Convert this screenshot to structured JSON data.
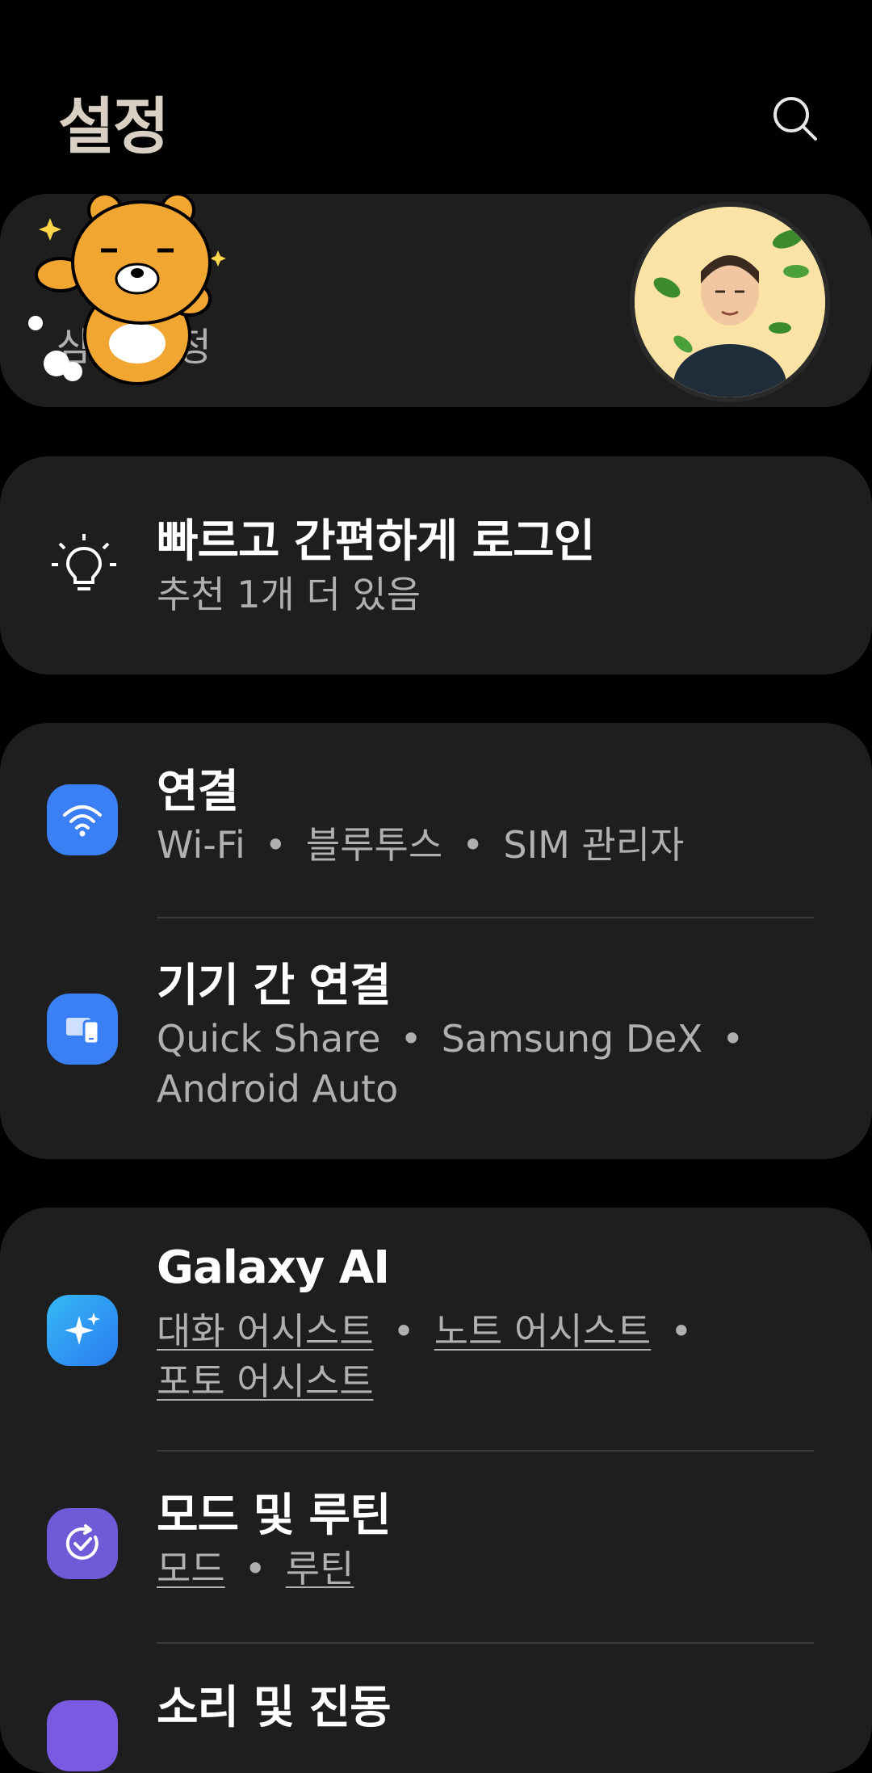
{
  "header": {
    "title": "설정",
    "search_icon": "search-icon"
  },
  "account": {
    "subtitle": "삼성 계정",
    "mascot": "bear-sticker",
    "avatar": "user-avatar"
  },
  "tip": {
    "icon": "lightbulb-icon",
    "title": "빠르고 간편하게 로그인",
    "subtitle": "추천 1개 더 있음"
  },
  "group1": [
    {
      "title": "연결",
      "icon": "wifi-icon",
      "color": "#3b7ff5",
      "sub": [
        "Wi-Fi",
        "블루투스",
        "SIM 관리자"
      ]
    },
    {
      "title": "기기 간 연결",
      "icon": "devices-icon",
      "color": "#3b7ff5",
      "sub_line1": [
        "Quick Share",
        "Samsung DeX"
      ],
      "sub_line2": "Android Auto"
    }
  ],
  "group2": [
    {
      "title": "Galaxy AI",
      "icon": "sparkle-icon",
      "color": "#2e9df5",
      "sub_line1": [
        "대화 어시스트",
        "노트 어시스트"
      ],
      "sub_line2": "포토 어시스트"
    },
    {
      "title": "모드 및 루틴",
      "icon": "check-routine-icon",
      "color": "#6e5bd8",
      "sub": [
        "모드",
        "루틴"
      ]
    },
    {
      "title": "소리 및 진동",
      "icon": "volume-icon",
      "color": "#7a5ae0"
    }
  ],
  "separator": "•"
}
